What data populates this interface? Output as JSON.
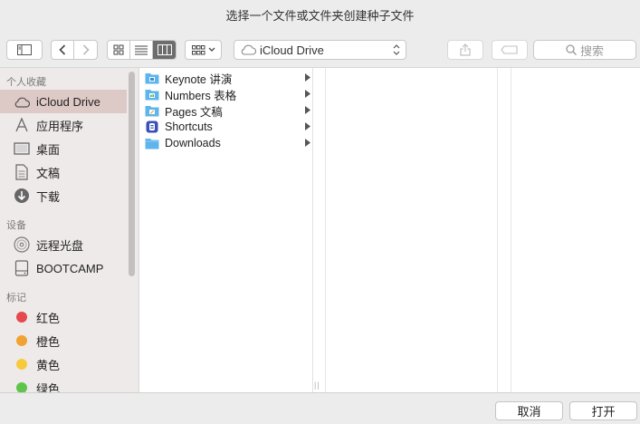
{
  "window": {
    "title": "选择一个文件或文件夹创建种子文件"
  },
  "toolbar": {
    "path_label": "iCloud Drive",
    "search_placeholder": "搜索",
    "view_modes": [
      "icon-view",
      "list-view",
      "column-view"
    ],
    "active_view": "column-view"
  },
  "sidebar": {
    "favorites_header": "个人收藏",
    "favorites": [
      {
        "label": "iCloud Drive",
        "icon": "cloud-icon",
        "selected": true
      },
      {
        "label": "应用程序",
        "icon": "applications-icon"
      },
      {
        "label": "桌面",
        "icon": "desktop-icon"
      },
      {
        "label": "文稿",
        "icon": "documents-icon"
      },
      {
        "label": "下载",
        "icon": "downloads-icon"
      }
    ],
    "devices_header": "设备",
    "devices": [
      {
        "label": "远程光盘",
        "icon": "optical-disc-icon"
      },
      {
        "label": "BOOTCAMP",
        "icon": "hard-drive-icon"
      }
    ],
    "tags_header": "标记",
    "tags": [
      {
        "label": "红色",
        "color": "#e5484d"
      },
      {
        "label": "橙色",
        "color": "#f0a232"
      },
      {
        "label": "黄色",
        "color": "#f5cb3b"
      },
      {
        "label": "绿色",
        "color": "#5fc44a"
      }
    ]
  },
  "browser": {
    "column1": [
      {
        "label": "Keynote 讲演",
        "icon": "keynote-folder-icon"
      },
      {
        "label": "Numbers 表格",
        "icon": "numbers-folder-icon"
      },
      {
        "label": "Pages 文稿",
        "icon": "pages-folder-icon"
      },
      {
        "label": "Shortcuts",
        "icon": "shortcuts-folder-icon"
      },
      {
        "label": "Downloads",
        "icon": "folder-icon"
      }
    ]
  },
  "footer": {
    "cancel_label": "取消",
    "open_label": "打开"
  },
  "colors": {
    "folder_blue": "#5fb4ec",
    "sidebar_selected": "#ddc9c6",
    "sidebar_bg": "#efeaea"
  }
}
